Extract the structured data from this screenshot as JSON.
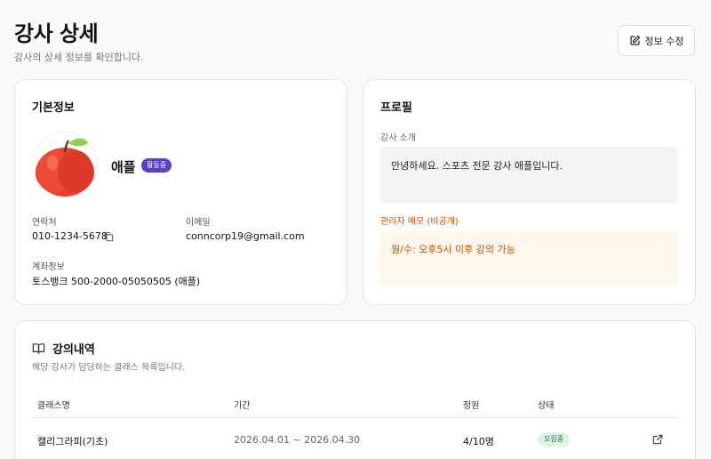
{
  "header": {
    "title": "강사 상세",
    "subtitle": "강사의 상세 정보를 확인합니다.",
    "edit_button_label": "정보 수정"
  },
  "basic_info": {
    "title": "기본정보",
    "name": "애플",
    "status_badge": "활동중",
    "phone_label": "연락처",
    "phone_value": "010-1234-5678",
    "email_label": "이메일",
    "email_value": "conncorp19@gmail.com",
    "account_label": "계좌정보",
    "account_value": "토스뱅크 500-2000-05050505 (애플)"
  },
  "profile": {
    "title": "프로필",
    "intro_label": "강사 소개",
    "intro_text": "안녕하세요. 스포츠 전문 강사 애플입니다.",
    "memo_label": "관리자 메모 (비공개)",
    "memo_text": "월/수: 오후5시 이후 강의 가능"
  },
  "classes": {
    "title": "강의내역",
    "subtitle": "해당 강사가 담당하는 클래스 목록입니다.",
    "columns": [
      "클래스명",
      "기간",
      "정원",
      "상태"
    ],
    "rows": [
      {
        "name": "캘리그라피(기초)",
        "period": "2026.04.01 ~ 2026.04.30",
        "capacity": "4/10명",
        "status": "모집중"
      }
    ]
  },
  "icons": {
    "edit": "edit-icon",
    "copy": "copy-icon",
    "book": "book-icon",
    "external_link": "external-link-icon",
    "avatar": "apple-avatar"
  },
  "colors": {
    "active_badge": "#5b3fc4",
    "recruit_badge_bg": "#dcf5e3",
    "recruit_badge_text": "#1a7a3a",
    "memo_text": "#c2530a",
    "memo_bg": "#fff7ea"
  }
}
